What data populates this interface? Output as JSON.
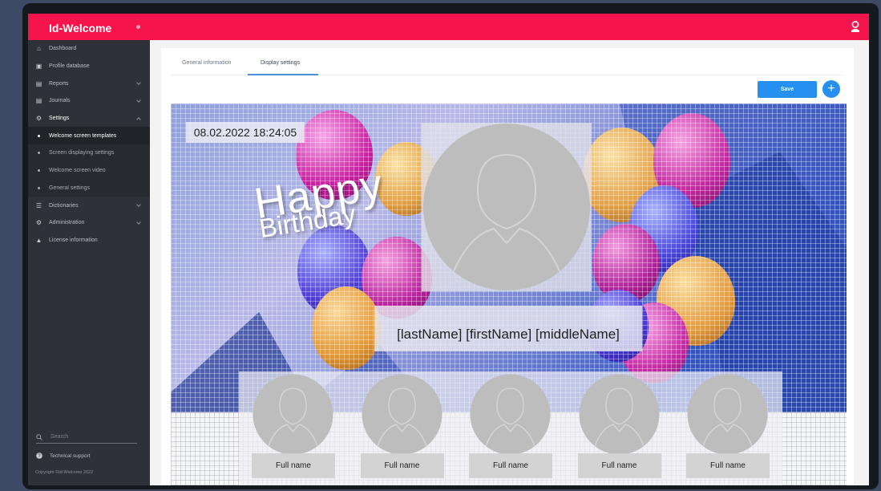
{
  "app": {
    "title": "Id-Welcome"
  },
  "sidebar": {
    "items": [
      {
        "label": "Dashboard",
        "icon": "home-icon"
      },
      {
        "label": "Profile database",
        "icon": "id-card-icon"
      },
      {
        "label": "Reports",
        "icon": "document-icon",
        "expandable": true
      },
      {
        "label": "Journals",
        "icon": "document-icon",
        "expandable": true
      },
      {
        "label": "Settings",
        "icon": "gear-icon",
        "expandable": true,
        "open": true
      },
      {
        "label": "Dictionaries",
        "icon": "list-icon",
        "expandable": true
      },
      {
        "label": "Administration",
        "icon": "gear-icon",
        "expandable": true
      },
      {
        "label": "License information",
        "icon": "license-icon"
      }
    ],
    "settings_sub": [
      {
        "label": "Welcome screen templates",
        "active": true
      },
      {
        "label": "Screen displaying settings"
      },
      {
        "label": "Welcome screen video"
      },
      {
        "label": "General settings"
      }
    ],
    "search_placeholder": "Search",
    "tech_support": "Technical support",
    "copyright": "Copyright ©Id-Welcome 2022"
  },
  "tabs": [
    {
      "label": "General information"
    },
    {
      "label": "Display settings",
      "active": true
    }
  ],
  "toolbar": {
    "save_label": "Save",
    "add_label": "+"
  },
  "template": {
    "datetime": "08.02.2022 18:24:05",
    "greeting_line1": "Happy",
    "greeting_line2": "Birthday",
    "name_placeholder": "[lastName] [firstName] [middleName]",
    "thumbnails": [
      {
        "label": "Full name"
      },
      {
        "label": "Full name"
      },
      {
        "label": "Full name"
      },
      {
        "label": "Full name"
      },
      {
        "label": "Full name"
      }
    ]
  },
  "colors": {
    "accent": "#f5144c",
    "sidebar": "#2e3238",
    "primary_button": "#2590f0"
  }
}
